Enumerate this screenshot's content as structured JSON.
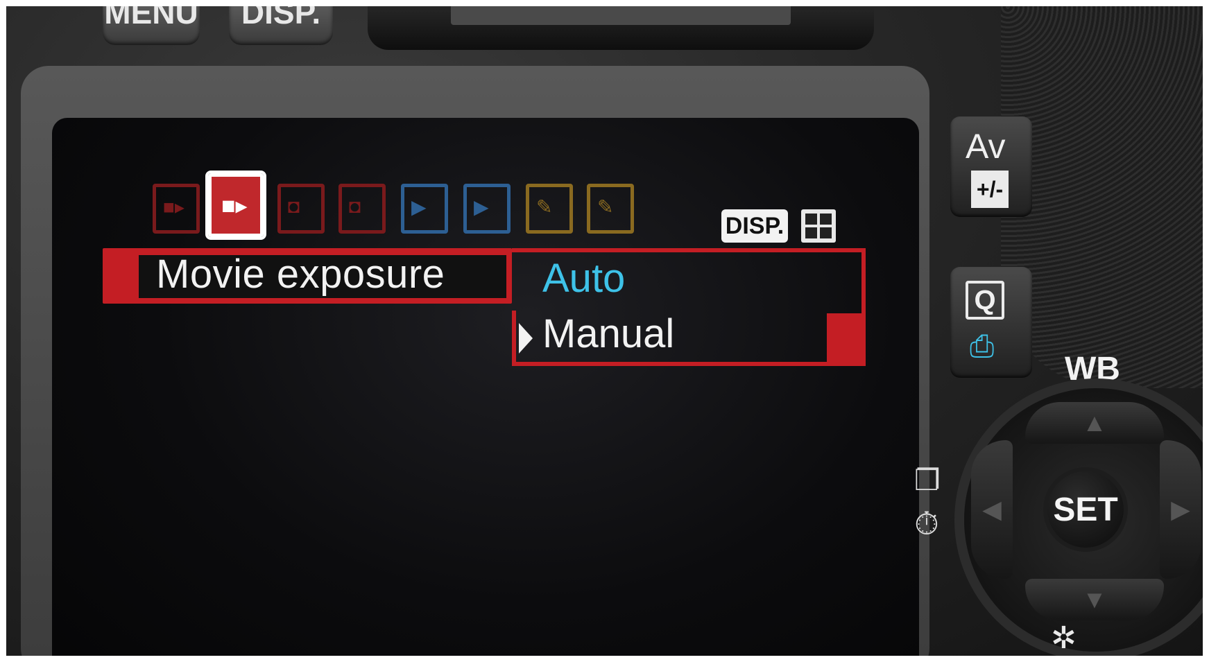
{
  "camera": {
    "top_buttons": {
      "menu_label": "MENU",
      "disp_label": "DISP."
    },
    "screen": {
      "tabs": [
        {
          "icon": "movie-camera-icon",
          "color": "#9b1e22",
          "active": false
        },
        {
          "icon": "movie-camera-icon",
          "color": "#c0282c",
          "active": true
        },
        {
          "icon": "movie-camera-icon",
          "color": "#9b1e22",
          "active": false
        },
        {
          "icon": "movie-camera-icon",
          "color": "#9b1e22",
          "active": false
        },
        {
          "icon": "playback-icon",
          "color": "#3a7cc0",
          "active": false
        },
        {
          "icon": "playback-icon",
          "color": "#3a7cc0",
          "active": false
        },
        {
          "icon": "wrench-icon",
          "color": "#b58a2a",
          "active": false
        },
        {
          "icon": "wrench-icon",
          "color": "#b58a2a",
          "active": false
        }
      ],
      "disp_badge": "DISP.",
      "menu_item_label": "Movie exposure",
      "options": {
        "auto": "Auto",
        "manual": "Manual"
      },
      "selected_option": "Manual"
    },
    "side_buttons": {
      "av": "Av",
      "av_sub": "+/-",
      "q": "Q"
    },
    "dial": {
      "wb_label": "WB",
      "set_label": "SET"
    }
  }
}
